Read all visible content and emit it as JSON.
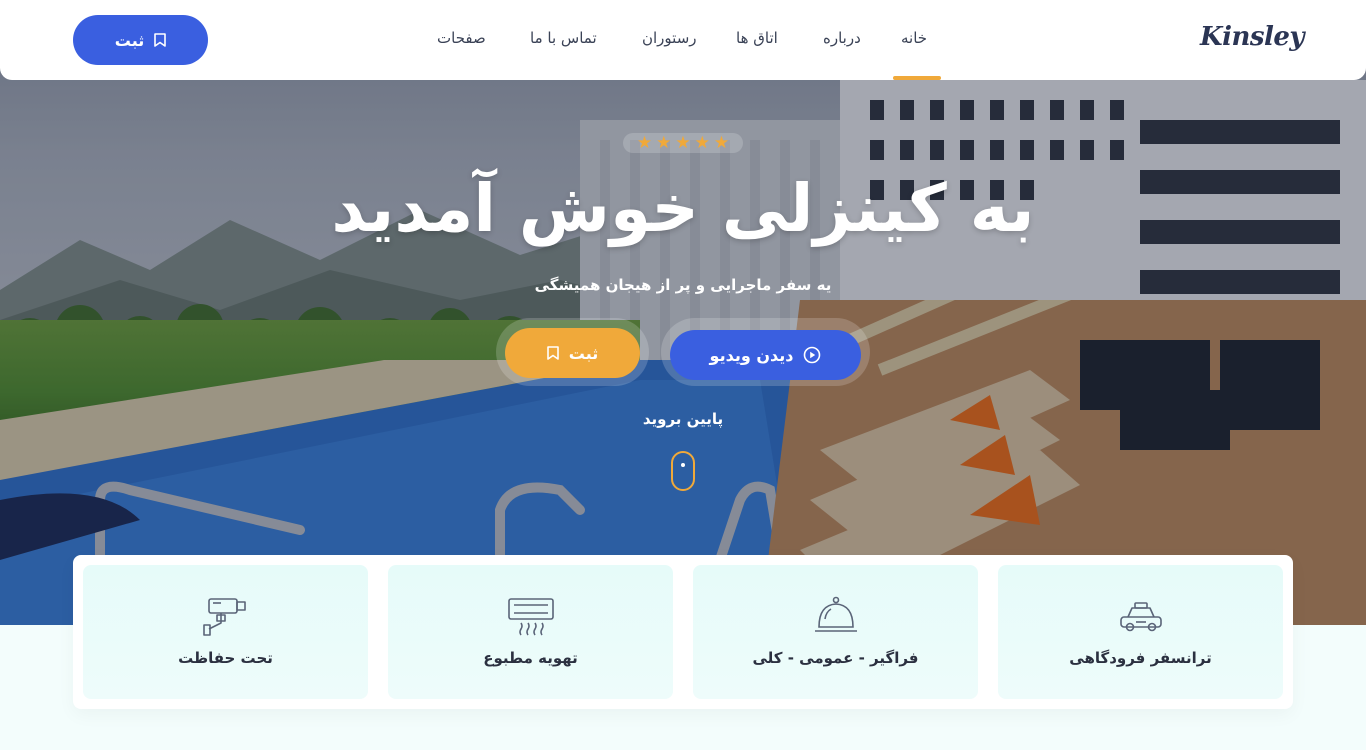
{
  "navbar": {
    "brand": "Kinsley",
    "items": [
      {
        "label": "خانه",
        "active": true
      },
      {
        "label": "درباره"
      },
      {
        "label": "اتاق ها"
      },
      {
        "label": "رستوران"
      },
      {
        "label": "تماس با ما"
      },
      {
        "label": "صفحات"
      }
    ],
    "book_label": "ثبت"
  },
  "hero": {
    "rating_stars": 5,
    "title": "به کینزلی خوش آمدید",
    "subtitle": "یه سفر ماجرایی و پر از هیجان همیشگی",
    "video_button": "دیدن ویدیو",
    "book_button": "ثبت",
    "scroll_label": "پایین بروید"
  },
  "features": [
    {
      "label": "ترانسفر فرودگاهی",
      "icon": "taxi-icon"
    },
    {
      "label": "فراگیر - عمومی - کلی",
      "icon": "room-service-bell-icon"
    },
    {
      "label": "تهویه مطبوع",
      "icon": "air-conditioner-icon"
    },
    {
      "label": "تحت حفاظت",
      "icon": "security-camera-icon"
    }
  ],
  "colors": {
    "primary": "#3a5fe0",
    "accent": "#f0a93a",
    "text_dark": "#2b3554",
    "feature_bg": "#e6fbf9"
  }
}
